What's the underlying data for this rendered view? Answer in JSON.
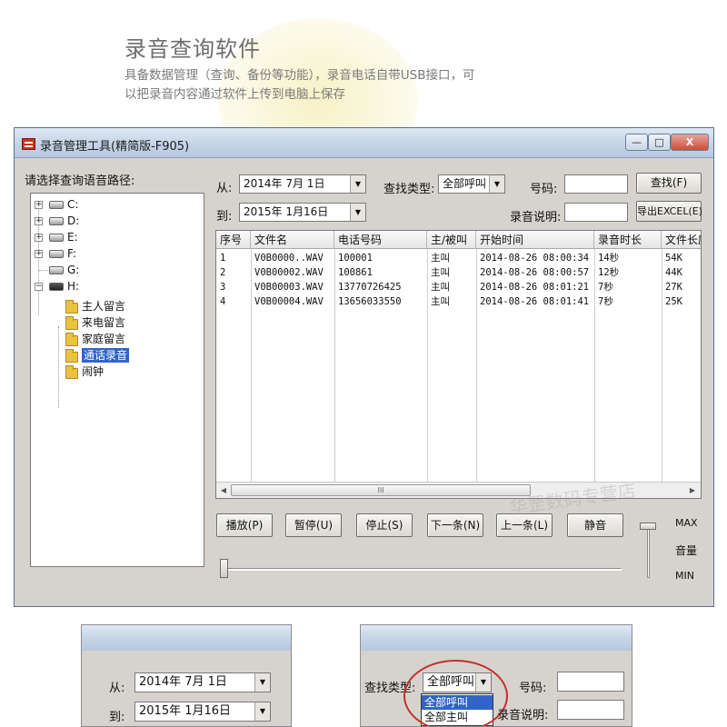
{
  "hero": {
    "title": "录音查询软件",
    "desc_line1": "具备数据管理（查询、备份等功能），录音电话自带USB接口，可",
    "desc_line2": "以把录音内容通过软件上传到电脑上保存"
  },
  "window": {
    "title": "录音管理工具(精简版-F905)",
    "min_glyph": "—",
    "max_glyph": "□",
    "close_glyph": "X"
  },
  "tree": {
    "label": "请选择查询语音路径:",
    "drives": [
      "C:",
      "D:",
      "E:",
      "F:",
      "G:",
      "H:"
    ],
    "folders": [
      "主人留言",
      "来电留言",
      "家庭留言",
      "通话录音",
      "闹钟"
    ],
    "selected": "通话录音"
  },
  "filters": {
    "from_label": "从:",
    "from_value": "2014年 7月 1日",
    "to_label": "到:",
    "to_value": "2015年 1月16日",
    "type_label": "查找类型:",
    "type_value": "全部呼叫",
    "number_label": "号码:",
    "note_label": "录音说明:",
    "search_button": "查找(F)",
    "export_button": "导出EXCEL(E)"
  },
  "grid": {
    "headers": [
      "序号",
      "文件名",
      "电话号码",
      "主/被叫",
      "开始时间",
      "录音时长",
      "文件长度"
    ],
    "rows": [
      [
        "1",
        "V0B0000..WAV",
        "100001",
        "主叫",
        "2014-08-26 08:00:34",
        "14秒",
        "54K"
      ],
      [
        "2",
        "V0B00002.WAV",
        "100861",
        "主叫",
        "2014-08-26 08:00:57",
        "12秒",
        "44K"
      ],
      [
        "3",
        "V0B00003.WAV",
        "13770726425",
        "主叫",
        "2014-08-26 08:01:21",
        "7秒",
        "27K"
      ],
      [
        "4",
        "V0B00004.WAV",
        "13656033550",
        "主叫",
        "2014-08-26 08:01:41",
        "7秒",
        "25K"
      ]
    ],
    "scroll_grip": "III"
  },
  "controls": {
    "play": "播放(P)",
    "pause": "暂停(U)",
    "stop": "停止(S)",
    "next": "下一条(N)",
    "prev": "上一条(L)",
    "mute": "静音",
    "vol_max": "MAX",
    "vol_label": "音量",
    "vol_min": "MIN"
  },
  "watermark": "华罡数码专营店",
  "crop_left": {
    "from_label": "从:",
    "from_value": "2014年 7月 1日",
    "to_label": "到:",
    "to_value": "2015年 1月16日"
  },
  "crop_right": {
    "type_label": "查找类型:",
    "type_value": "全部呼叫",
    "number_label": "号码:",
    "note_label": "录音说明:",
    "options": [
      "全部呼叫",
      "全部主叫"
    ]
  },
  "colors": {
    "selection": "#3164c8",
    "window_face": "#d6d3ce",
    "annotation_circle": "#c2302a"
  }
}
